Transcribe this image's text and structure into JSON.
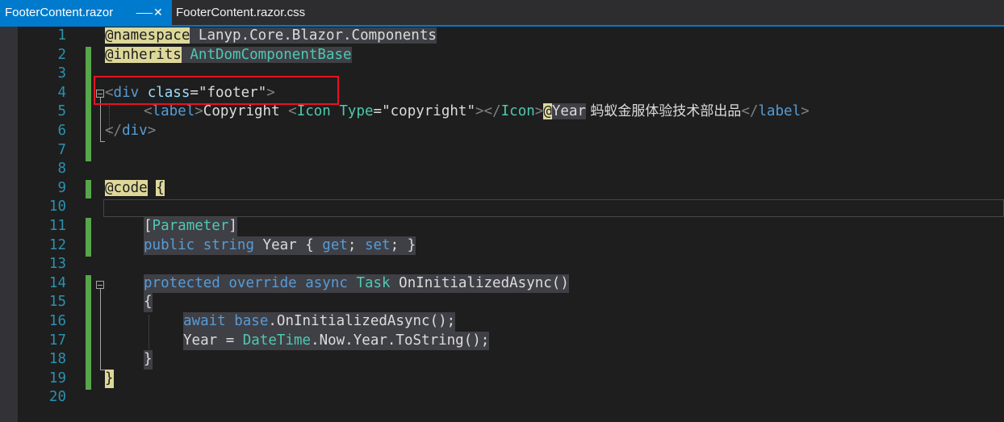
{
  "tabs": [
    {
      "label": "FooterContent.razor",
      "active": true,
      "pin_icon": "pin-icon",
      "close_icon": "close-icon"
    },
    {
      "label": "FooterContent.razor.css",
      "active": false
    }
  ],
  "editor": {
    "line_numbers": [
      "1",
      "2",
      "3",
      "4",
      "5",
      "6",
      "7",
      "8",
      "9",
      "10",
      "11",
      "12",
      "13",
      "14",
      "15",
      "16",
      "17",
      "18",
      "19",
      "20"
    ],
    "code": {
      "l1": {
        "directive": "@namespace",
        "value": "Lanyp.Core.Blazor.Components"
      },
      "l2": {
        "directive": "@inherits",
        "value": "AntDomComponentBase"
      },
      "l4": {
        "open": "<",
        "tag": "div",
        "attr": "class",
        "eq": "=",
        "val": "\"footer\"",
        "close": ">"
      },
      "l5": {
        "lt": "<",
        "label": "label",
        "gt": ">",
        "text": "Copyright ",
        "icon_lt": "<",
        "icon": "Icon",
        "type_attr": "Type",
        "eq": "=",
        "type_val": "\"copyright\"",
        "icon_gt": ">",
        "icon_end": "</",
        "icon2": "Icon",
        "icon_end_gt": ">",
        "at": "@",
        "year": "Year",
        "cn": " 蚂蚁金服体验技术部出品",
        "end_lt": "</",
        "label2": "label",
        "end_gt": ">"
      },
      "l6": {
        "lt": "</",
        "tag": "div",
        "gt": ">"
      },
      "l9": {
        "directive": "@code",
        "brace": "{"
      },
      "l11": {
        "lbr": "[",
        "attr": "Parameter",
        "rbr": "]"
      },
      "l12": {
        "kw1": "public",
        "kw2": "string",
        "name": "Year",
        "rest1": " { ",
        "get": "get",
        "semi1": "; ",
        "set": "set",
        "semi2": "; }"
      },
      "l14": {
        "kw1": "protected",
        "kw2": "override",
        "kw3": "async",
        "type": "Task",
        "method": "OnInitializedAsync()"
      },
      "l15": {
        "brace": "{"
      },
      "l16": {
        "kw1": "await",
        "kw2": "base",
        "rest": ".OnInitializedAsync();"
      },
      "l17": {
        "name": "Year",
        "eq": " = ",
        "type": "DateTime",
        "rest": ".Now.Year.ToString();"
      },
      "l18": {
        "brace": "}"
      },
      "l19": {
        "brace": "}"
      }
    }
  },
  "colors": {
    "tab_active_bg": "#007acc",
    "editor_bg": "#1e1e1e",
    "line_number": "#2b91af",
    "keyword": "#569cd6",
    "type": "#4ec9b0",
    "string": "#d69d85",
    "razor_highlight": "#ddd89a",
    "change_bar": "#57a64a",
    "annotation_box": "#e81123"
  }
}
